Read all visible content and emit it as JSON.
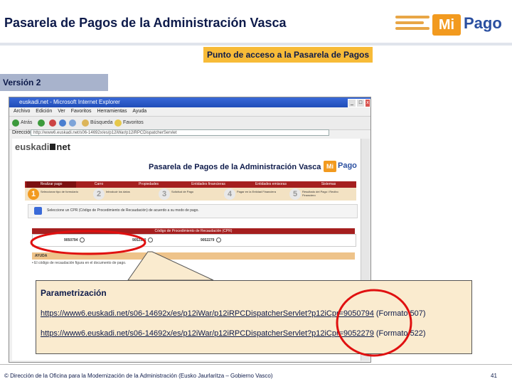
{
  "header": {
    "title": "Pasarela de Pagos de la Administración Vasca",
    "logo": {
      "box": "Mi",
      "word": "Pago"
    },
    "colors": {
      "title": "#0d1a4a",
      "accent": "#f29a1f",
      "logo_blue": "#2a4fa0"
    }
  },
  "access_label": "Punto de acceso a la Pasarela de Pagos",
  "version_label": "Versión 2",
  "browser": {
    "window_title": "euskadi.net - Microsoft Internet Explorer",
    "menu": [
      "Archivo",
      "Edición",
      "Ver",
      "Favoritos",
      "Herramientas",
      "Ayuda"
    ],
    "toolbar": [
      "Atrás",
      "Búsqueda",
      "Favoritos"
    ],
    "address_label": "Dirección",
    "address_value": "http://www6.euskadi.net/s06-14692x/es/p12iWar/p12iRPCDispatcherServlet",
    "page": {
      "site_logo_a": "euskadi",
      "site_logo_b": "net",
      "title": "Pasarela de Pagos de la Administración Vasca",
      "inner_logo": {
        "box": "Mi",
        "word": "Pago"
      },
      "tabs": [
        "Realizar pago",
        "Carro",
        "Propiedades",
        "Entidades financieras",
        "Entidades emisoras",
        "Sistemas"
      ],
      "steps": [
        {
          "num": "1",
          "text": "Seleccionar tipo de formulario"
        },
        {
          "num": "2",
          "text": "Introducir los datos"
        },
        {
          "num": "3",
          "text": "Solicitud de Pago"
        },
        {
          "num": "4",
          "text": "Pagar en la Entidad Financiera"
        },
        {
          "num": "5",
          "text": "Resultado del Pago / Recibo Financiero"
        }
      ],
      "select_text": "Seleccione un CPR (Código de Procedimiento de Recaudación) de acuerdo a su modo de pago.",
      "cpr_header": "Código de Procedimiento de Recaudación (CPR)",
      "cpr_options": [
        "9050794",
        "9052180",
        "9052279"
      ],
      "ayuda_label": "AYUDA",
      "ayuda_text": "• El código de recaudación figura en el documento de pago."
    }
  },
  "callout": {
    "title": "Parametrización",
    "links": [
      {
        "url": "https://www6.euskadi.net/s06-14692x/es/p12iWar/p12iRPCDispatcherServlet?p12iCpr=9050794",
        "format": "(Formato 507)"
      },
      {
        "url": "https://www6.euskadi.net/s06-14692x/es/p12iWar/p12iRPCDispatcherServlet?p12iCpr=9052279",
        "format": "(Formato  522)"
      }
    ]
  },
  "footer": {
    "text": "© Dirección de la Oficina para la Modernización de la Administración (Eusko Jaurlaritza – Gobierno Vasco)",
    "page_number": "41"
  }
}
